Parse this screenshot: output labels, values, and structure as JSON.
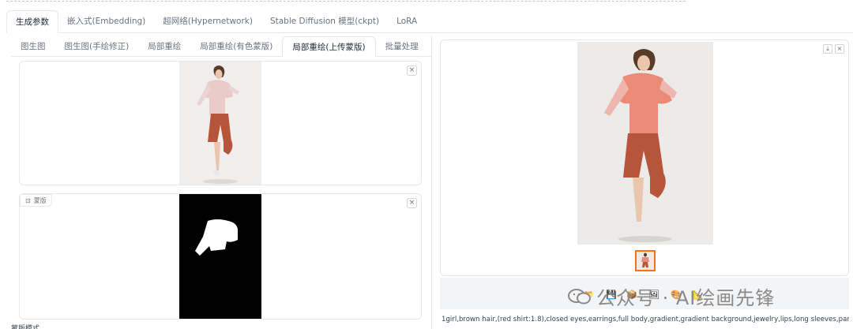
{
  "main_tabs": [
    {
      "label": "生成参数",
      "active": true
    },
    {
      "label": "嵌入式(Embedding)",
      "active": false
    },
    {
      "label": "超网络(Hypernetwork)",
      "active": false
    },
    {
      "label": "Stable Diffusion 模型(ckpt)",
      "active": false
    },
    {
      "label": "LoRA",
      "active": false
    }
  ],
  "sub_tabs": [
    {
      "label": "图生图",
      "active": false
    },
    {
      "label": "图生图(手绘修正)",
      "active": false
    },
    {
      "label": "局部重绘",
      "active": false
    },
    {
      "label": "局部重绘(有色蒙版)",
      "active": false
    },
    {
      "label": "局部重绘(上传蒙版)",
      "active": true
    },
    {
      "label": "批量处理",
      "active": false
    }
  ],
  "upload_image": {
    "close": "×"
  },
  "mask_image": {
    "label": "蒙版",
    "close": "×"
  },
  "below_label": "蒙版模式",
  "output": {
    "download": "⤓",
    "close": "×",
    "toolbar_icons": [
      "folder-icon",
      "save-icon",
      "zip-icon",
      "send-to-img2img-icon",
      "send-to-inpaint-icon",
      "send-to-extras-icon"
    ],
    "watermark": "公众号 · AI绘画先锋"
  },
  "prompt": "1girl,brown hair,(red shirt:1.8),closed eyes,earrings,full body,gradient,gradient background,jewelry,lips,long sleeves,pants,shoes,short"
}
